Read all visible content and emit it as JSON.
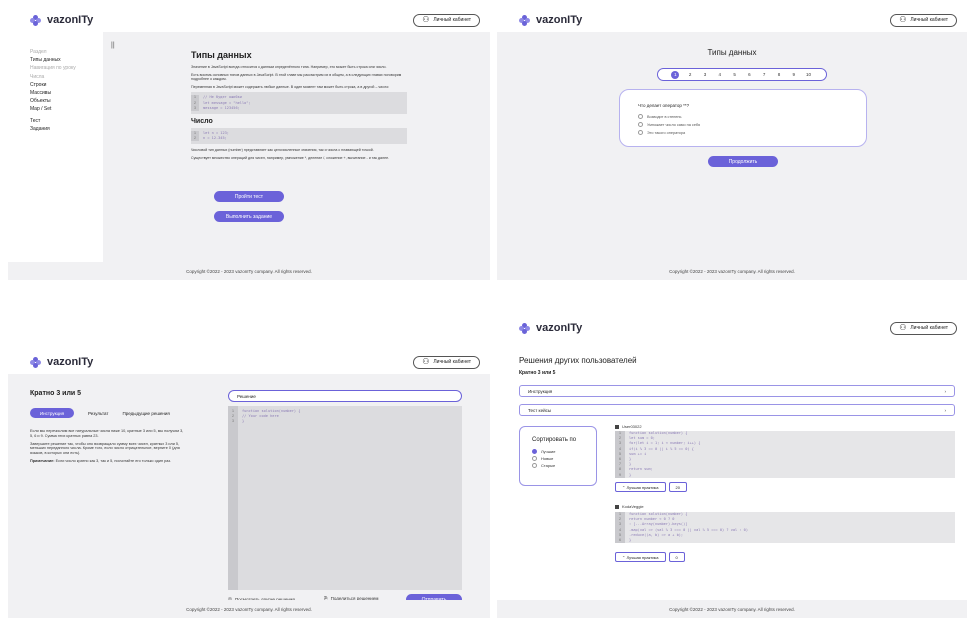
{
  "brand": {
    "name": "vazonITy"
  },
  "header": {
    "account_label": "Личный кабинет"
  },
  "footer": {
    "copyright": "Copyright ©2022 - 2023 vazonITy company. All rights reserved."
  },
  "lesson": {
    "mark": "||",
    "sidebar": [
      {
        "label": "Раздел",
        "muted": true
      },
      {
        "label": "Типы данных",
        "muted": false
      },
      {
        "label": "Навигация по уроку",
        "muted": true
      },
      {
        "label": "Числа",
        "muted": true
      },
      {
        "label": "Строки",
        "muted": false
      },
      {
        "label": "Массивы",
        "muted": false
      },
      {
        "label": "Объекты",
        "muted": false
      },
      {
        "label": "Map / Set",
        "muted": false
      },
      {
        "label": "Тест",
        "muted": false
      },
      {
        "label": "Задания",
        "muted": false
      }
    ],
    "title": "Типы данных",
    "p1": "Значение в JavaScript всегда относится к данным определённого типа. Например, это может быть строка или число.",
    "p2": "Есть восемь основных типов данных в JavaScript. В этой главе мы рассмотрим их в общем, а в следующих главах поговорим подробнее о каждом.",
    "p3": "Переменная в JavaScript может содержать любые данные. В один момент там может быть строка, а в другой – число:",
    "code1": [
      "// Не будет ошибки",
      "let message = \"hello\";",
      "message = 123456;"
    ],
    "subtitle": "Число",
    "code2": [
      "let n = 123;",
      "n = 12.345;"
    ],
    "p4": "Числовой тип данных (number) представляет как целочисленные значения, так и числа с плавающей точкой.",
    "p5": "Существует множество операций для чисел, например, умножение *, деление /, сложение +, вычитание - и так далее.",
    "btn_test": "Пройти тест",
    "btn_tasks": "Выполнить задание"
  },
  "quiz": {
    "title": "Типы данных",
    "pages": [
      "1",
      "2",
      "3",
      "4",
      "5",
      "6",
      "7",
      "8",
      "9",
      "10"
    ],
    "active_page": "1",
    "question": "Что делает оператор **?",
    "options": [
      "Возводит в степень",
      "Умножает число само на себя",
      "Это такого оператора"
    ],
    "btn_next": "Продолжить"
  },
  "task": {
    "title": "Кратно 3 или 5",
    "tabs": [
      "Инструкция",
      "Результат",
      "Предыдущие решения"
    ],
    "desc1": "Если мы перечислим все натуральные числа ниже 10, кратные 3 или 5, мы получим 3, 5, 6 и 9. Сумма этих кратных равна 23.",
    "desc2": "Завершите решение так, чтобы оно возвращало сумму всех чисел, кратных 3 или 5, меньших переданного числа. Кроме того, если число отрицательное, верните 0 (для языков, в которых они есть).",
    "note_label": "Примечание:",
    "note": "Если число кратно как 3, так и 5, посчитайте его только один раз.",
    "solution_label": "Решение",
    "code": [
      "function solution(number) {",
      "  // Your code here",
      "}"
    ],
    "view_others": "Посмотреть другие решения",
    "share": "Поделиться решением",
    "send": "Отправить"
  },
  "others": {
    "title": "Решения других пользователей",
    "subtitle": "Кратно 3 или 5",
    "acc_instruction": "Инструкция",
    "acc_tests": "Тест кейсы",
    "sort_title": "Сортировать по",
    "sort_options": [
      "Лучшие",
      "Новые",
      "Старые"
    ],
    "sort_active": "Лучшие",
    "users": [
      {
        "name": "User03022",
        "code": [
          "function solution(number) {",
          "  let sum = 0;",
          "  for(let i = 1; i < number; i++) {",
          "    if(i % 3 == 0 || i % 5 == 0) {",
          "      sum += i",
          "    }",
          "  }",
          "  return sum;",
          "}"
        ],
        "like_label": "Лучшая практика",
        "like_count": "20"
      },
      {
        "name": "KodaVeggie",
        "code": [
          "function solution(number) {",
          "  return number < 0 ? 0",
          "    : [...Array(number).keys()]",
          "      .map(val => (val % 3 === 0 || val % 5 === 0) ? val : 0)",
          "      .reduce((a, b) => a + b);",
          "}"
        ],
        "like_label": "Лучшая практика",
        "like_count": "0"
      }
    ]
  }
}
